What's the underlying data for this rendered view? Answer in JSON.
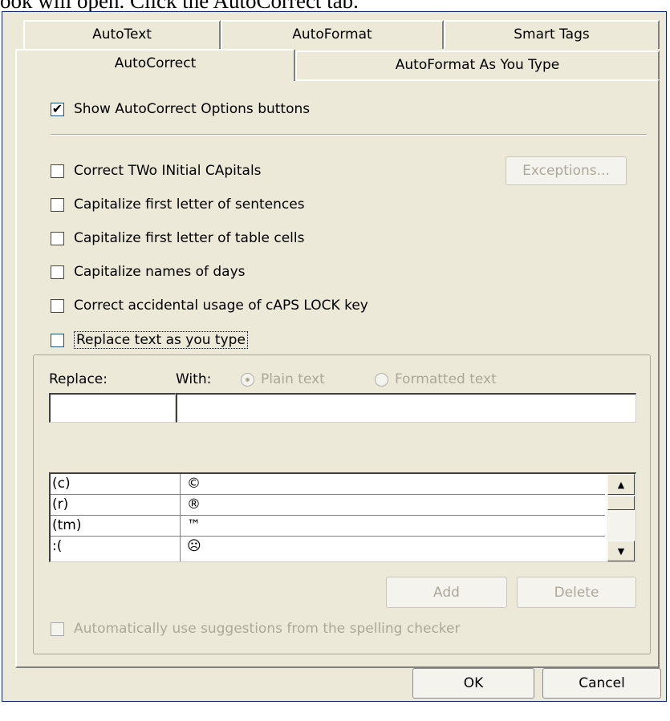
{
  "caption": "ook will open. Click the AutoCorrect tab.",
  "tabs_back": [
    {
      "label": "AutoText"
    },
    {
      "label": "AutoFormat"
    },
    {
      "label": "Smart Tags"
    }
  ],
  "tabs_front": [
    {
      "label": "AutoCorrect",
      "active": true
    },
    {
      "label": "AutoFormat As You Type"
    }
  ],
  "options": {
    "show_buttons": {
      "label": "Show AutoCorrect Options buttons",
      "checked": true
    },
    "correct_two_initial": {
      "label": "Correct TWo INitial CApitals",
      "checked": false
    },
    "capitalize_sentences": {
      "label": "Capitalize first letter of sentences",
      "checked": false
    },
    "capitalize_table_cells": {
      "label": "Capitalize first letter of table cells",
      "checked": false
    },
    "capitalize_days": {
      "label": "Capitalize names of days",
      "checked": false
    },
    "caps_lock": {
      "label": "Correct accidental usage of cAPS LOCK key",
      "checked": false
    },
    "replace_text": {
      "label": "Replace text as you type",
      "checked": false
    }
  },
  "buttons": {
    "exceptions": "Exceptions...",
    "add": "Add",
    "delete": "Delete",
    "ok": "OK",
    "cancel": "Cancel"
  },
  "replace": {
    "replace_label": "Replace:",
    "with_label": "With:",
    "plain_text": "Plain text",
    "formatted_text": "Formatted text",
    "replace_value": "",
    "with_value": ""
  },
  "entries": [
    {
      "from": "(c)",
      "to": "©"
    },
    {
      "from": "(r)",
      "to": "®"
    },
    {
      "from": "(tm)",
      "to": "™"
    },
    {
      "from": ":(",
      "to": "☹"
    }
  ],
  "auto_suggest": {
    "label": "Automatically use suggestions from the spelling checker",
    "checked": false
  }
}
